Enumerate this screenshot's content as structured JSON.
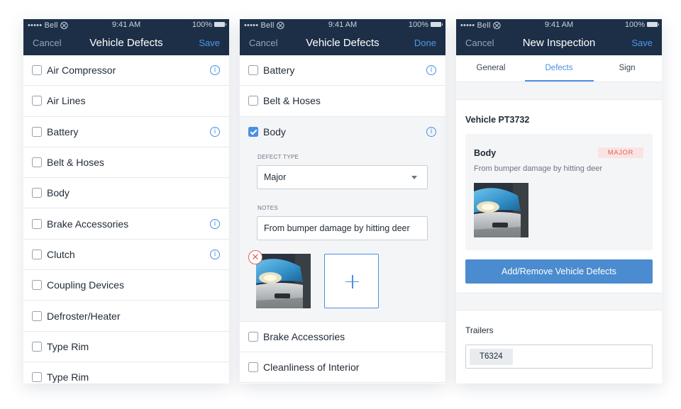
{
  "status": {
    "carrier": "••••• Bell ⨂",
    "time": "9:41 AM",
    "battery": "100%"
  },
  "screen1": {
    "nav": {
      "left": "Cancel",
      "title": "Vehicle Defects",
      "right": "Save"
    },
    "items": [
      {
        "label": "Air Compressor",
        "info": true
      },
      {
        "label": "Air Lines",
        "info": false
      },
      {
        "label": "Battery",
        "info": true
      },
      {
        "label": "Belt & Hoses",
        "info": false
      },
      {
        "label": "Body",
        "info": false
      },
      {
        "label": "Brake Accessories",
        "info": true
      },
      {
        "label": "Clutch",
        "info": true
      },
      {
        "label": "Coupling Devices",
        "info": false
      },
      {
        "label": "Defroster/Heater",
        "info": false
      },
      {
        "label": "Type Rim",
        "info": false
      },
      {
        "label": "Type Rim",
        "info": false
      }
    ]
  },
  "screen2": {
    "nav": {
      "left": "Cancel",
      "title": "Vehicle Defects",
      "right": "Done"
    },
    "items_top": [
      {
        "label": "Battery",
        "info": true
      },
      {
        "label": "Belt & Hoses",
        "info": false
      }
    ],
    "expanded": {
      "label": "Body",
      "checked": true,
      "defect_type_label": "DEFECT TYPE",
      "defect_type_value": "Major",
      "notes_label": "NOTES",
      "notes_value": "From bumper damage by hitting deer"
    },
    "items_bottom": [
      {
        "label": "Brake Accessories"
      },
      {
        "label": "Cleanliness of Interior"
      }
    ]
  },
  "screen3": {
    "nav": {
      "left": "Cancel",
      "title": "New Inspection",
      "right": "Save"
    },
    "tabs": [
      {
        "label": "General"
      },
      {
        "label": "Defects",
        "active": true
      },
      {
        "label": "Sign"
      }
    ],
    "vehicle_title": "Vehicle PT3732",
    "defect": {
      "name": "Body",
      "severity": "MAJOR",
      "note": "From bumper damage by hitting deer"
    },
    "cta": "Add/Remove Vehicle Defects",
    "trailers_label": "Trailers",
    "trailer_chip": "T6324"
  },
  "colors": {
    "navbar": "#1d2f47",
    "accent": "#4a90e2",
    "danger": "#e2625a",
    "panel": "#f4f5f7"
  },
  "icons": {
    "info": "info-circle-icon",
    "remove": "remove-circle-icon",
    "add": "plus-icon",
    "dropdown": "chevron-down-icon"
  }
}
